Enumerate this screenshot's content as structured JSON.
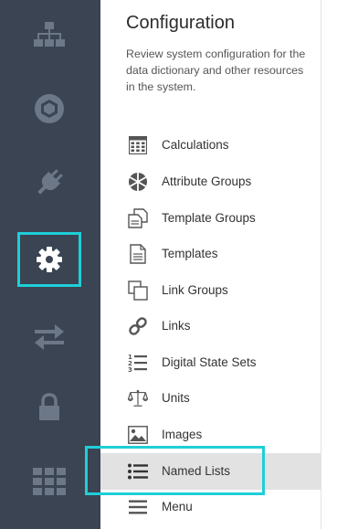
{
  "rail": {
    "items": [
      {
        "icon": "hierarchy-icon"
      },
      {
        "icon": "hexagon-icon"
      },
      {
        "icon": "plug-icon"
      },
      {
        "icon": "gear-icon",
        "active": true
      },
      {
        "icon": "transfer-arrows-icon"
      },
      {
        "icon": "lock-icon"
      },
      {
        "icon": "grid-icon"
      }
    ],
    "colors": {
      "background": "#3a4452",
      "icon": "#6c7888",
      "active_icon": "#ffffff",
      "highlight": "#1ecfd8"
    }
  },
  "panel": {
    "title": "Configuration",
    "description": "Review system configuration for the data dictionary and other resources in the system.",
    "items": [
      {
        "label": "Calculations",
        "icon": "calculator-icon"
      },
      {
        "label": "Attribute Groups",
        "icon": "attribute-groups-icon"
      },
      {
        "label": "Template Groups",
        "icon": "template-groups-icon"
      },
      {
        "label": "Templates",
        "icon": "template-icon"
      },
      {
        "label": "Link Groups",
        "icon": "link-groups-icon"
      },
      {
        "label": "Links",
        "icon": "link-icon"
      },
      {
        "label": "Digital State Sets",
        "icon": "numbered-list-icon"
      },
      {
        "label": "Units",
        "icon": "scales-icon"
      },
      {
        "label": "Images",
        "icon": "image-icon"
      },
      {
        "label": "Named Lists",
        "icon": "bulleted-list-icon",
        "selected": true
      },
      {
        "label": "Menu",
        "icon": "hamburger-menu-icon"
      }
    ]
  }
}
